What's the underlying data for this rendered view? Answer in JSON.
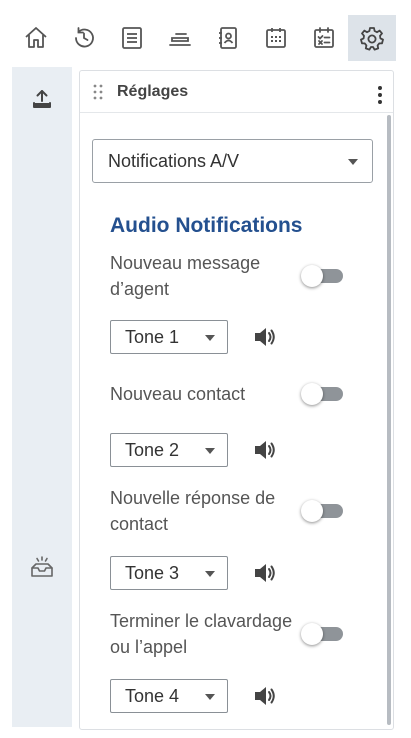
{
  "toolbar": {
    "items": [
      {
        "icon": "home-icon"
      },
      {
        "icon": "history-icon"
      },
      {
        "icon": "notes-icon"
      },
      {
        "icon": "stack-icon"
      },
      {
        "icon": "contacts-icon"
      },
      {
        "icon": "calendar-icon"
      },
      {
        "icon": "tasks-icon"
      },
      {
        "icon": "gear-icon",
        "active": true
      }
    ]
  },
  "rail": {
    "items": [
      {
        "icon": "upload-icon"
      },
      {
        "icon": "inbox-icon"
      }
    ]
  },
  "panel": {
    "title": "Réglages",
    "select_value": "Notifications A/V"
  },
  "audio": {
    "section_title": "Audio Notifications",
    "notifications": [
      {
        "label": "Nouveau message d’agent",
        "tone": "Tone 1",
        "enabled": false
      },
      {
        "label": "Nouveau contact",
        "tone": "Tone 2",
        "enabled": false
      },
      {
        "label": "Nouvelle réponse de contact",
        "tone": "Tone 3",
        "enabled": false
      },
      {
        "label": "Terminer le clavardage ou l’appel",
        "tone": "Tone 4",
        "enabled": false
      }
    ]
  },
  "colors": {
    "accent": "#24508f",
    "rail_bg": "#e9eef3",
    "active_tab_bg": "#dde3e9"
  }
}
